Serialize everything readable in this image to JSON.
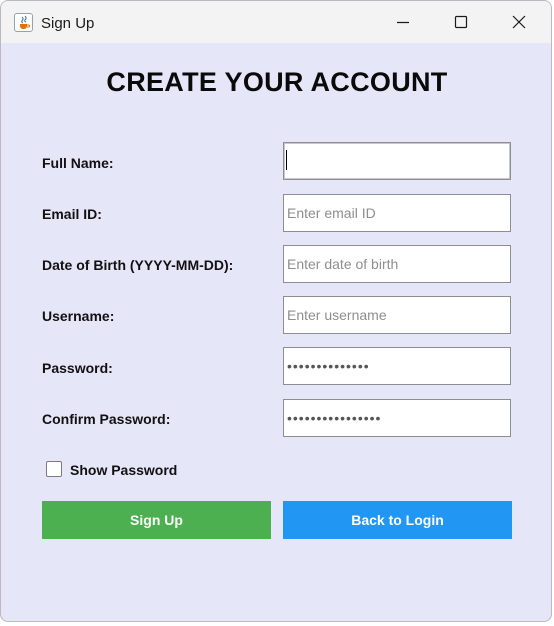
{
  "window": {
    "title": "Sign Up",
    "icon": "java-cup-icon",
    "controls": [
      "minimize-icon",
      "maximize-icon",
      "close-icon"
    ]
  },
  "form": {
    "heading": "CREATE YOUR ACCOUNT",
    "fields": {
      "full_name": {
        "label": "Full Name:",
        "value": "",
        "placeholder": ""
      },
      "email": {
        "label": "Email ID:",
        "value": "",
        "placeholder": "Enter email ID"
      },
      "dob": {
        "label": "Date of Birth (YYYY-MM-DD):",
        "value": "",
        "placeholder": "Enter date of birth"
      },
      "username": {
        "label": "Username:",
        "value": "",
        "placeholder": "Enter username"
      },
      "password": {
        "label": "Password:",
        "masked_value": "••••••••••••••"
      },
      "confirm_password": {
        "label": "Confirm Password:",
        "masked_value": "••••••••••••••••"
      }
    },
    "show_password": {
      "label": "Show Password",
      "checked": false
    },
    "buttons": {
      "signup": {
        "label": "Sign Up",
        "color": "#4caf50"
      },
      "back": {
        "label": "Back to Login",
        "color": "#2196f3"
      }
    }
  },
  "colors": {
    "background": "#e6e6f9",
    "titlebar": "#f3f3f3"
  }
}
